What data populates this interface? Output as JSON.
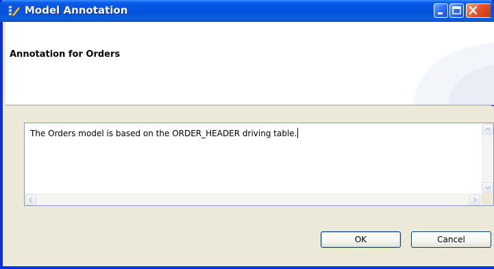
{
  "window": {
    "title": "Model Annotation"
  },
  "header": {
    "title": "Annotation for Orders"
  },
  "annotation": {
    "text": "The Orders model is based on the ORDER_HEADER driving table."
  },
  "buttons": {
    "ok": "OK",
    "cancel": "Cancel"
  },
  "icons": {
    "app": "model-annotation-icon",
    "minimize": "minimize-icon",
    "maximize": "maximize-icon",
    "close": "close-icon"
  },
  "colors": {
    "titlebar": "#0554e0",
    "window_border": "#0831d9",
    "dialog_face": "#ece9d8",
    "close_button": "#e0532a"
  }
}
